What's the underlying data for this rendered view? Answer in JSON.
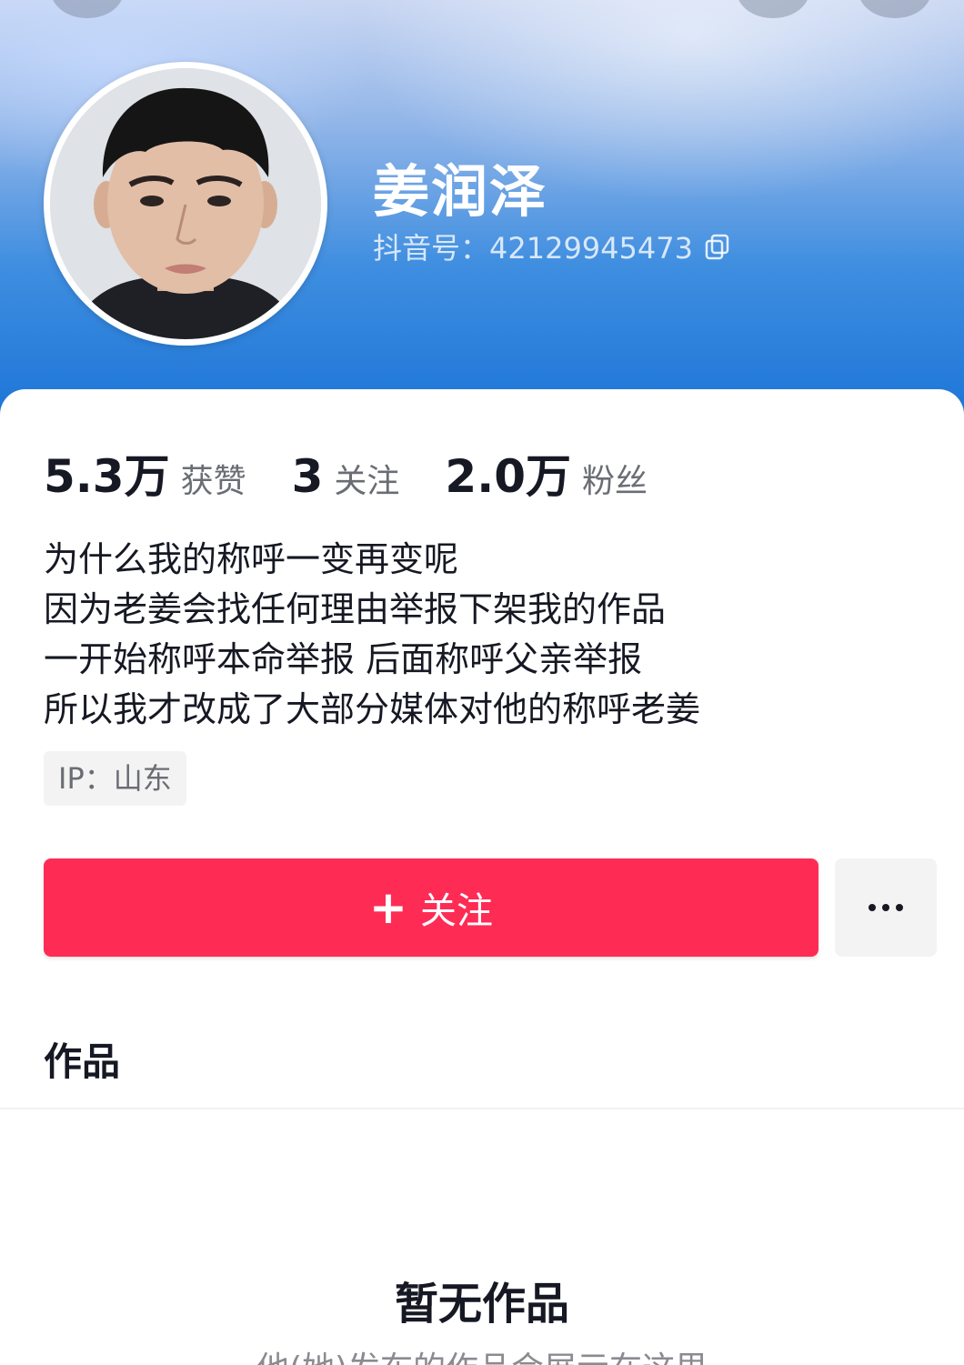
{
  "profile": {
    "username": "姜润泽",
    "douyin_id": "抖音号：42129945473"
  },
  "stats": {
    "likes_value": "5.3万",
    "likes_label": "获赞",
    "following_value": "3",
    "following_label": "关注",
    "followers_value": "2.0万",
    "followers_label": "粉丝"
  },
  "bio": {
    "lines": [
      "为什么我的称呼一变再变呢",
      "因为老姜会找任何理由举报下架我的作品",
      "一开始称呼本命举报 后面称呼父亲举报",
      "所以我才改成了大部分媒体对他的称呼老姜"
    ]
  },
  "ip_tag": "IP：山东",
  "actions": {
    "follow_plus": "+",
    "follow_label": "关注"
  },
  "works": {
    "section_title": "作品",
    "empty_title": "暂无作品",
    "empty_subtitle": "他(她)发布的作品会展示在这里"
  },
  "colors": {
    "accent": "#fe2c55",
    "text_primary": "#161823",
    "text_secondary": "#6b6d74",
    "banner_blue": "#1b74d6"
  }
}
